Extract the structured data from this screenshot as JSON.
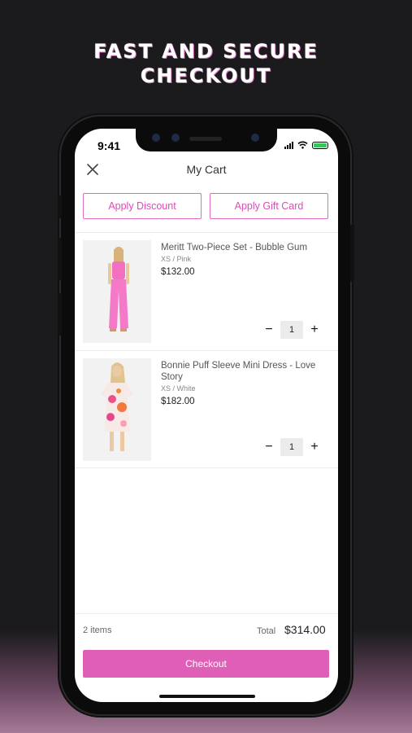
{
  "promo": {
    "line1": "FAST AND SECURE",
    "line2": "CHECKOUT"
  },
  "status_bar": {
    "time": "9:41"
  },
  "header": {
    "title": "My Cart",
    "close_icon": "close-icon"
  },
  "actions": {
    "discount_label": "Apply Discount",
    "gift_card_label": "Apply Gift Card"
  },
  "cart": {
    "items": [
      {
        "name": "Meritt Two-Piece Set - Bubble Gum",
        "variant": "XS / Pink",
        "price": "$132.00",
        "quantity": "1"
      },
      {
        "name": "Bonnie Puff Sleeve Mini Dress - Love Story",
        "variant": "XS / White",
        "price": "$182.00",
        "quantity": "1"
      }
    ]
  },
  "summary": {
    "items_count": "2 items",
    "total_label": "Total",
    "total_value": "$314.00"
  },
  "checkout": {
    "label": "Checkout"
  },
  "colors": {
    "accent": "#df5fb6",
    "accent_text": "#d94fb1",
    "background": "#1b1b1d"
  }
}
